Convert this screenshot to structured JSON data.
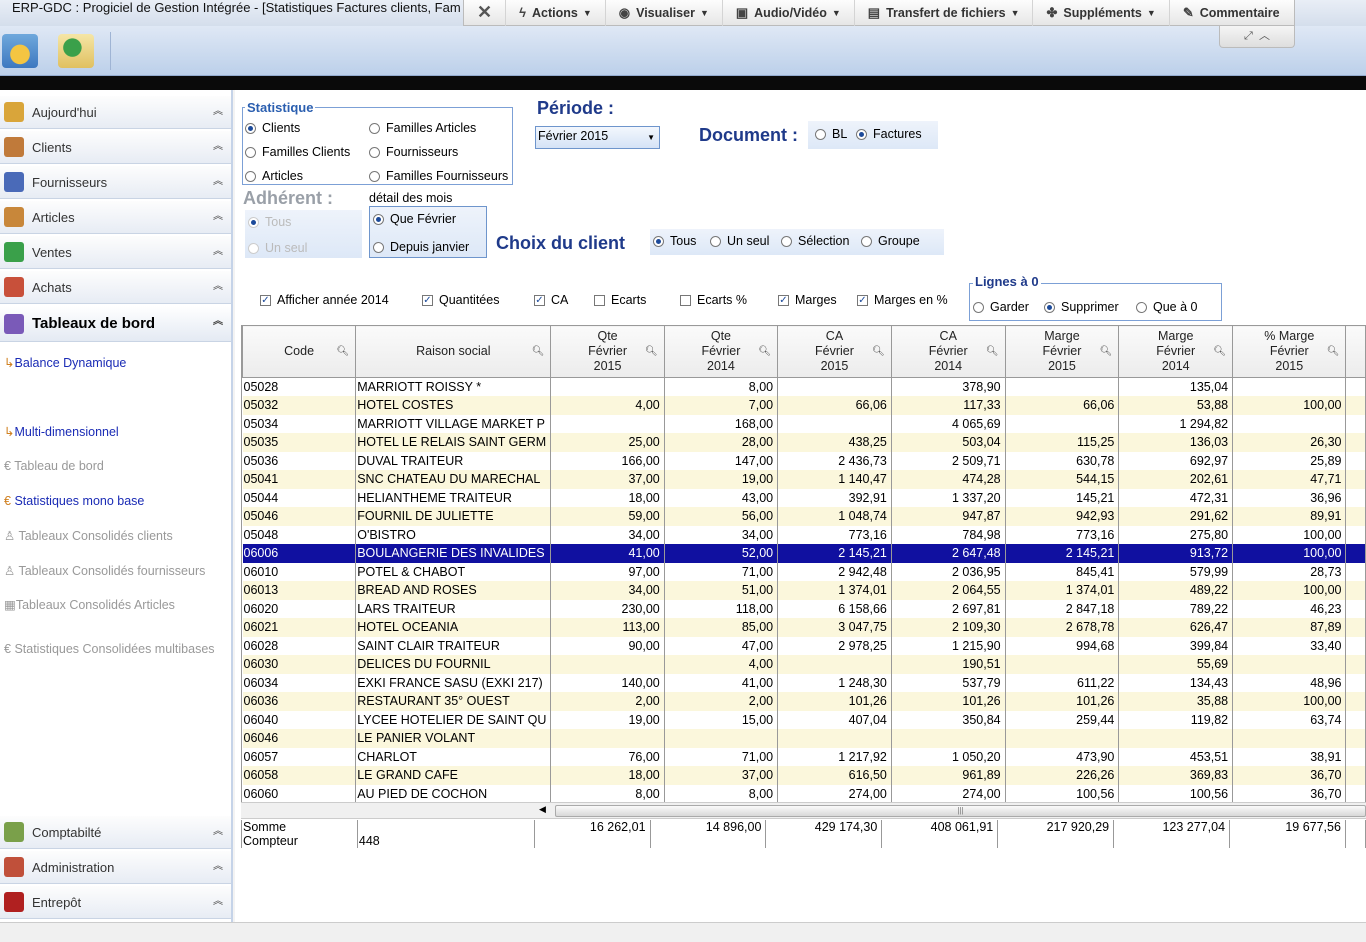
{
  "window": {
    "title": "ERP-GDC : Progiciel de Gestion Intégrée - [Statistiques Factures clients, Fam"
  },
  "remote_toolbar": {
    "items": [
      {
        "label": "Actions",
        "icon": "bolt-icon"
      },
      {
        "label": "Visualiser",
        "icon": "eye-icon"
      },
      {
        "label": "Audio/Vidéo",
        "icon": "chat-icon"
      },
      {
        "label": "Transfert de fichiers",
        "icon": "file-icon"
      },
      {
        "label": "Suppléments",
        "icon": "puzzle-icon"
      },
      {
        "label": "Commentaire",
        "icon": "edit-icon"
      }
    ]
  },
  "sidebar": {
    "top": [
      {
        "label": "Aujourd'hui",
        "color": "#d9a53a"
      },
      {
        "label": "Clients",
        "color": "#c07a3a"
      },
      {
        "label": "Fournisseurs",
        "color": "#4a6ab8"
      },
      {
        "label": "Articles",
        "color": "#c8873a"
      },
      {
        "label": "Ventes",
        "color": "#3aa04a"
      },
      {
        "label": "Achats",
        "color": "#c8503a"
      },
      {
        "label": "Tableaux de bord",
        "color": "#7a5ab8"
      }
    ],
    "subitems": [
      {
        "label": "Balance Dynamique",
        "enabled": true
      },
      {
        "label": "Multi-dimensionnel",
        "enabled": true
      },
      {
        "label": "Tableau de bord",
        "enabled": false
      },
      {
        "label": "Statistiques mono base",
        "enabled": true
      },
      {
        "label": "Tableaux Consolidés clients",
        "enabled": false
      },
      {
        "label": "Tableaux Consolidés fournisseurs",
        "enabled": false
      },
      {
        "label": "Tableaux Consolidés Articles",
        "enabled": false
      },
      {
        "label": "Statistiques Consolidées multibases",
        "enabled": false
      }
    ],
    "bottom": [
      {
        "label": "Comptabilté",
        "color": "#7aa04a"
      },
      {
        "label": "Administration",
        "color": "#c0503a"
      },
      {
        "label": "Entrepôt",
        "color": "#b02020"
      }
    ]
  },
  "statistique": {
    "legend": "Statistique",
    "options": [
      "Clients",
      "Familles Articles",
      "Familles Clients",
      "Fournisseurs",
      "Articles",
      "Familles Fournisseurs"
    ],
    "selected": "Clients"
  },
  "periode": {
    "label": "Période :",
    "value": "Février 2015"
  },
  "document": {
    "label": "Document :",
    "options": [
      "BL",
      "Factures"
    ],
    "selected": "Factures"
  },
  "adherent": {
    "label": "Adhérent :",
    "options": [
      "Tous",
      "Un seul"
    ]
  },
  "detail": {
    "label": "détail des mois",
    "options": [
      "Que Février",
      "Depuis janvier"
    ],
    "selected": "Que Février"
  },
  "choix_client": {
    "label": "Choix du client",
    "options": [
      "Tous",
      "Un seul",
      "Sélection",
      "Groupe"
    ],
    "selected": "Tous"
  },
  "checks": [
    {
      "label": "Afficher année 2014",
      "checked": true
    },
    {
      "label": "Quantitées",
      "checked": true
    },
    {
      "label": "CA",
      "checked": true
    },
    {
      "label": "Ecarts",
      "checked": false
    },
    {
      "label": "Ecarts %",
      "checked": false
    },
    {
      "label": "Marges",
      "checked": true
    },
    {
      "label": "Marges en %",
      "checked": true
    }
  ],
  "lignes": {
    "legend": "Lignes à 0",
    "options": [
      "Garder",
      "Supprimer",
      "Que à 0"
    ],
    "selected": "Supprimer"
  },
  "table": {
    "headers": [
      "Code",
      "Raison social",
      "Qte Février 2015",
      "Qte Février 2014",
      "CA Février 2015",
      "CA Février 2014",
      "Marge Février 2015",
      "Marge Février 2014",
      "% Marge Février 2015"
    ],
    "rows": [
      [
        "05028",
        "MARRIOTT ROISSY *",
        "",
        "8,00",
        "",
        "378,90",
        "",
        "135,04",
        ""
      ],
      [
        "05032",
        "HOTEL COSTES",
        "4,00",
        "7,00",
        "66,06",
        "117,33",
        "66,06",
        "53,88",
        "100,00"
      ],
      [
        "05034",
        "MARRIOTT VILLAGE MARKET P",
        "",
        "168,00",
        "",
        "4 065,69",
        "",
        "1 294,82",
        ""
      ],
      [
        "05035",
        "HOTEL LE RELAIS SAINT GERM",
        "25,00",
        "28,00",
        "438,25",
        "503,04",
        "115,25",
        "136,03",
        "26,30"
      ],
      [
        "05036",
        "DUVAL TRAITEUR",
        "166,00",
        "147,00",
        "2 436,73",
        "2 509,71",
        "630,78",
        "692,97",
        "25,89"
      ],
      [
        "05041",
        "SNC CHATEAU DU MARECHAL",
        "37,00",
        "19,00",
        "1 140,47",
        "474,28",
        "544,15",
        "202,61",
        "47,71"
      ],
      [
        "05044",
        "HELIANTHEME TRAITEUR",
        "18,00",
        "43,00",
        "392,91",
        "1 337,20",
        "145,21",
        "472,31",
        "36,96"
      ],
      [
        "05046",
        "FOURNIL DE JULIETTE",
        "59,00",
        "56,00",
        "1 048,74",
        "947,87",
        "942,93",
        "291,62",
        "89,91"
      ],
      [
        "05048",
        "O'BISTRO",
        "34,00",
        "34,00",
        "773,16",
        "784,98",
        "773,16",
        "275,80",
        "100,00"
      ],
      [
        "06006",
        "BOULANGERIE DES INVALIDES",
        "41,00",
        "52,00",
        "2 145,21",
        "2 647,48",
        "2 145,21",
        "913,72",
        "100,00"
      ],
      [
        "06010",
        "POTEL & CHABOT",
        "97,00",
        "71,00",
        "2 942,48",
        "2 036,95",
        "845,41",
        "579,99",
        "28,73"
      ],
      [
        "06013",
        "BREAD AND ROSES",
        "34,00",
        "51,00",
        "1 374,01",
        "2 064,55",
        "1 374,01",
        "489,22",
        "100,00"
      ],
      [
        "06020",
        "LARS TRAITEUR",
        "230,00",
        "118,00",
        "6 158,66",
        "2 697,81",
        "2 847,18",
        "789,22",
        "46,23"
      ],
      [
        "06021",
        "HOTEL OCEANIA",
        "113,00",
        "85,00",
        "3 047,75",
        "2 109,30",
        "2 678,78",
        "626,47",
        "87,89"
      ],
      [
        "06028",
        "SAINT CLAIR TRAITEUR",
        "90,00",
        "47,00",
        "2 978,25",
        "1 215,90",
        "994,68",
        "399,84",
        "33,40"
      ],
      [
        "06030",
        "DELICES DU FOURNIL",
        "",
        "4,00",
        "",
        "190,51",
        "",
        "55,69",
        ""
      ],
      [
        "06034",
        "EXKI FRANCE SASU (EXKI 217)",
        "140,00",
        "41,00",
        "1 248,30",
        "537,79",
        "611,22",
        "134,43",
        "48,96"
      ],
      [
        "06036",
        "RESTAURANT 35° OUEST",
        "2,00",
        "2,00",
        "101,26",
        "101,26",
        "101,26",
        "35,88",
        "100,00"
      ],
      [
        "06040",
        "LYCEE HOTELIER DE SAINT QU",
        "19,00",
        "15,00",
        "407,04",
        "350,84",
        "259,44",
        "119,82",
        "63,74"
      ],
      [
        "06046",
        "LE PANIER VOLANT",
        "",
        "",
        "",
        "",
        "",
        "",
        ""
      ],
      [
        "06057",
        "CHARLOT",
        "76,00",
        "71,00",
        "1 217,92",
        "1 050,20",
        "473,90",
        "453,51",
        "38,91"
      ],
      [
        "06058",
        "LE GRAND CAFE",
        "18,00",
        "37,00",
        "616,50",
        "961,89",
        "226,26",
        "369,83",
        "36,70"
      ],
      [
        "06060",
        "AU PIED DE COCHON",
        "8,00",
        "8,00",
        "274,00",
        "274,00",
        "100,56",
        "100,56",
        "36,70"
      ]
    ],
    "selected_row": 9,
    "footer": {
      "somme_label": "Somme",
      "compteur_label": "Compteur",
      "compteur": "448",
      "sums": [
        "16 262,01",
        "14 896,00",
        "429 174,30",
        "408 061,91",
        "217 920,29",
        "123 277,04",
        "19 677,56"
      ]
    }
  }
}
